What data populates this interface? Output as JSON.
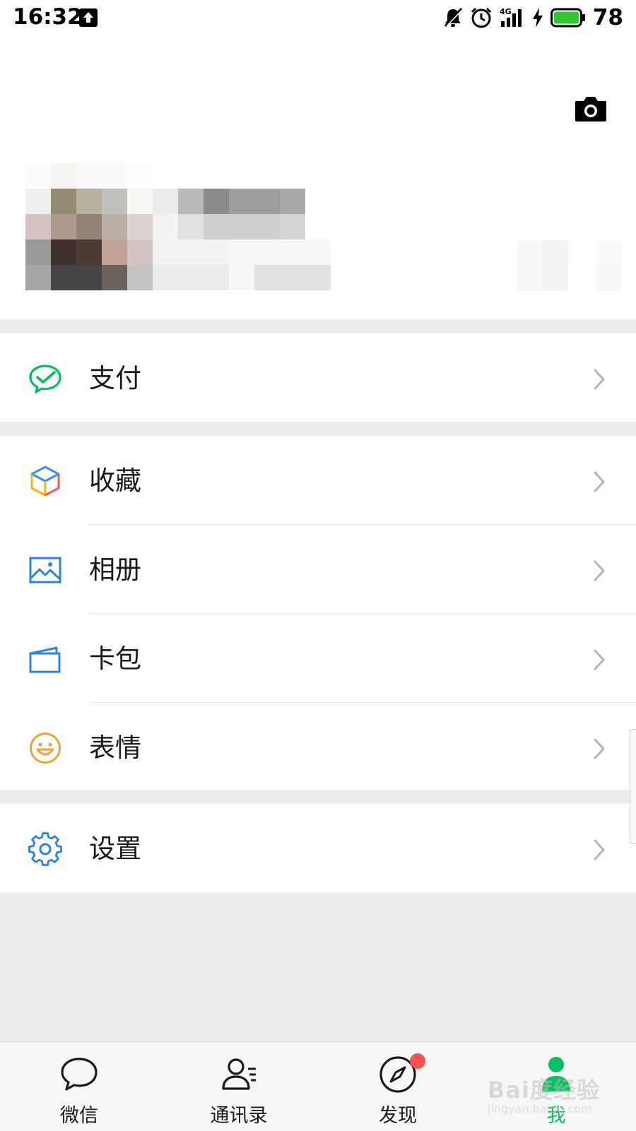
{
  "status_bar": {
    "time": "16:32",
    "network": "4G",
    "battery": "78",
    "icons": [
      "upload-icon",
      "mute-icon",
      "alarm-icon",
      "signal-icon",
      "charging-icon",
      "battery-icon"
    ]
  },
  "header": {
    "camera_icon": "camera-icon"
  },
  "menu": {
    "pay": {
      "label": "支付",
      "icon": "wechat-pay-icon"
    },
    "favorites": {
      "label": "收藏",
      "icon": "cube-icon"
    },
    "album": {
      "label": "相册",
      "icon": "image-icon"
    },
    "cards": {
      "label": "卡包",
      "icon": "card-icon"
    },
    "stickers": {
      "label": "表情",
      "icon": "smiley-icon"
    },
    "settings": {
      "label": "设置",
      "icon": "gear-icon"
    }
  },
  "tabbar": {
    "items": [
      {
        "label": "微信",
        "icon": "chat-bubble-icon"
      },
      {
        "label": "通讯录",
        "icon": "contacts-icon"
      },
      {
        "label": "发现",
        "icon": "compass-icon",
        "badge": true
      },
      {
        "label": "我",
        "icon": "person-icon",
        "active": true
      }
    ]
  },
  "watermark": {
    "text": "Bai度经验",
    "sub": "jingyan.baidu.com"
  },
  "colors": {
    "accent": "#07c160",
    "badge": "#fa5151",
    "background": "#ededed"
  }
}
